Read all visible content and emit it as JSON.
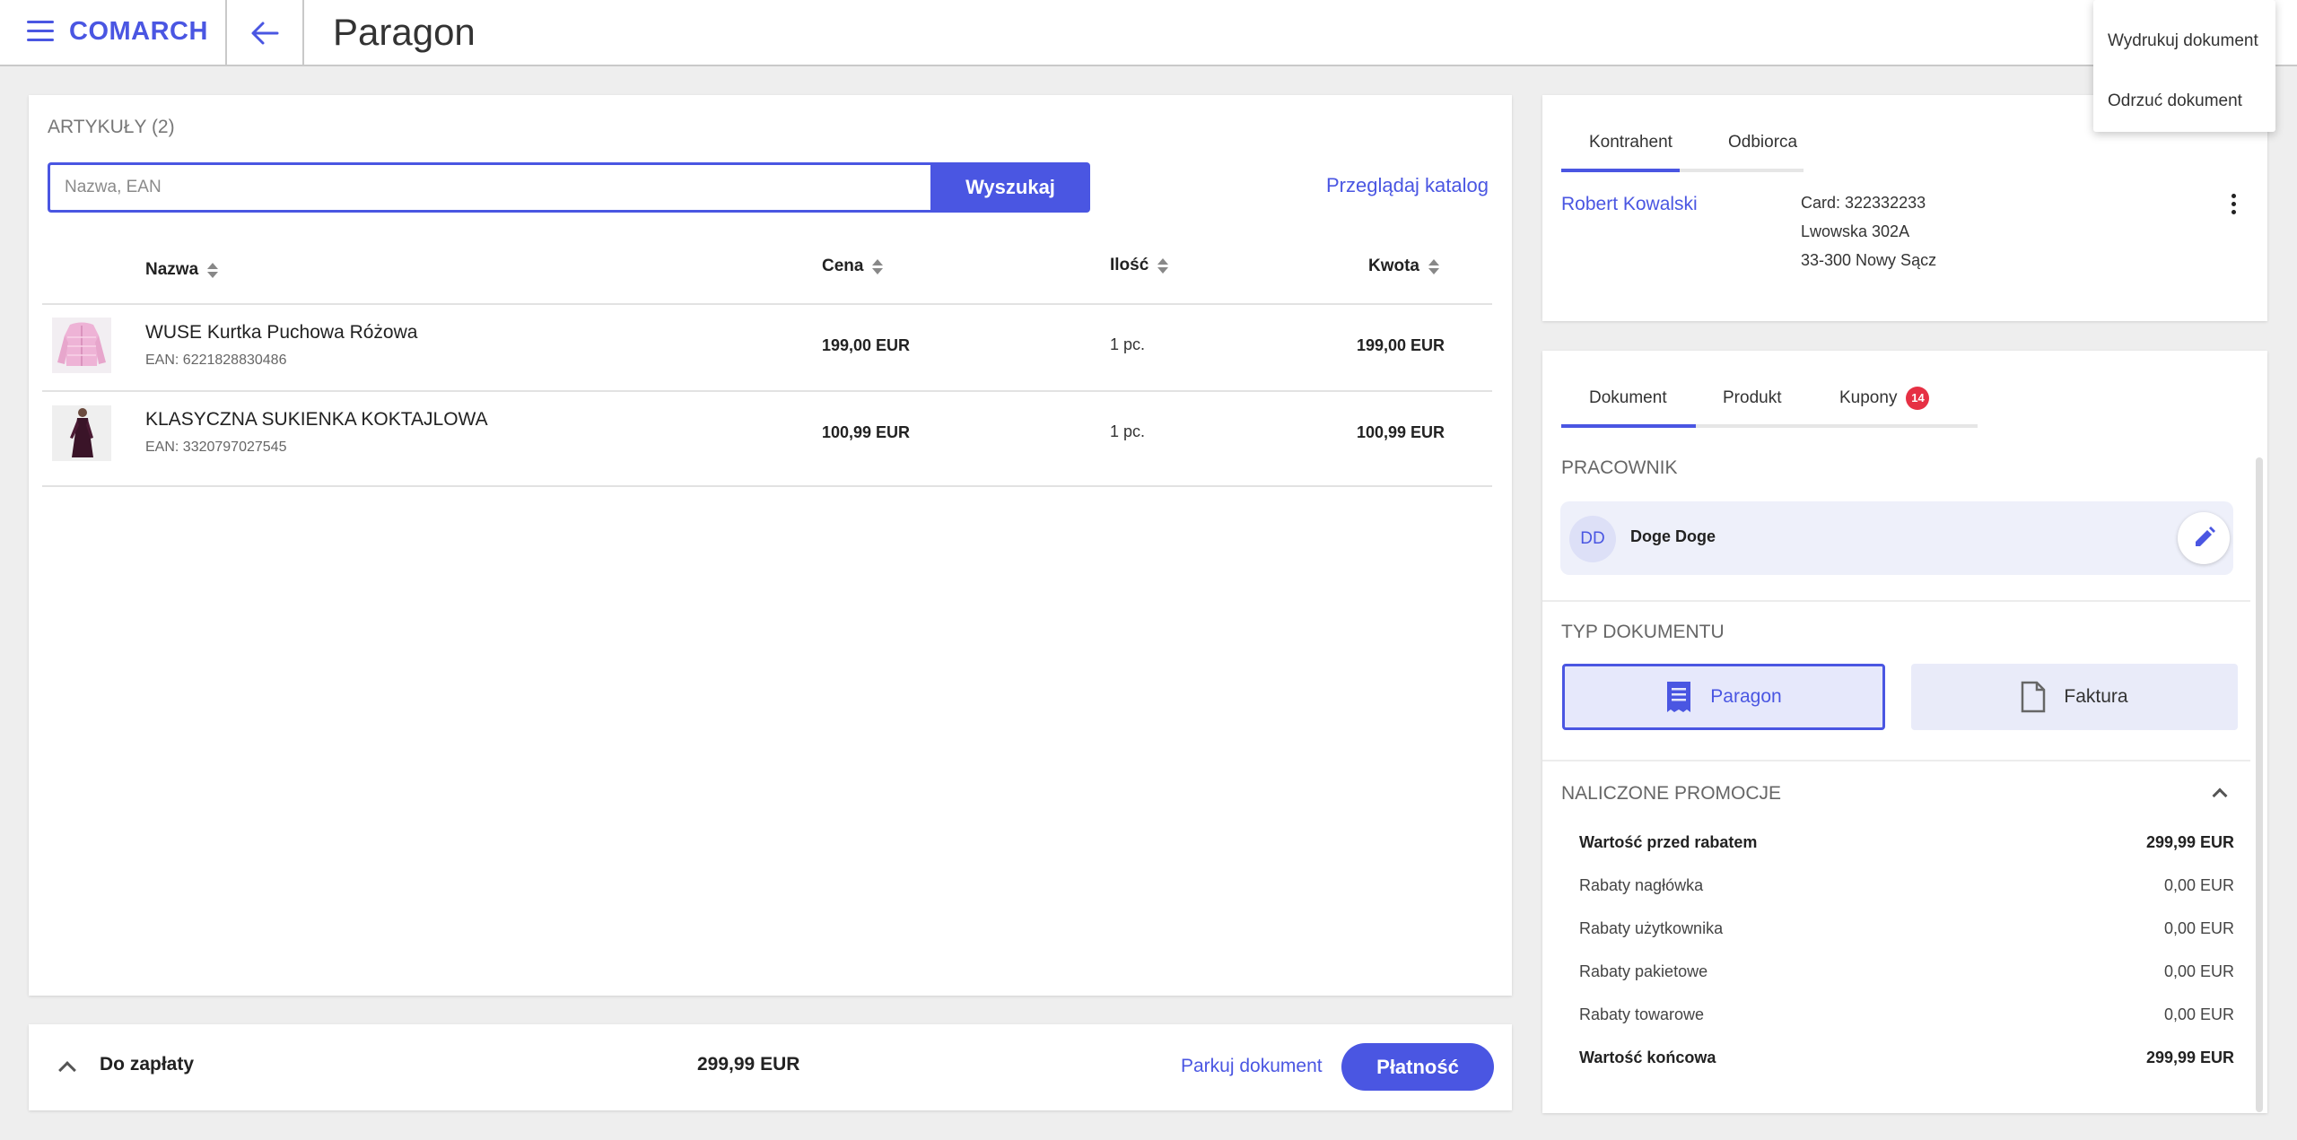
{
  "header": {
    "logo": "COMARCH",
    "title": "Paragon"
  },
  "menu": {
    "items": [
      "Wydrukuj dokument",
      "Odrzuć dokument"
    ]
  },
  "articles": {
    "title": "ARTYKUŁY (2)",
    "search_placeholder": "Nazwa, EAN",
    "search_button": "Wyszukaj",
    "catalog_link": "Przeglądaj katalog",
    "columns": [
      "Nazwa",
      "Cena",
      "Ilość",
      "Kwota"
    ],
    "rows": [
      {
        "name": "WUSE Kurtka Puchowa Różowa",
        "ean": "EAN: 6221828830486",
        "price": "199,00 EUR",
        "qty": "1 pc.",
        "amount": "199,00 EUR",
        "thumb": "pink-jacket"
      },
      {
        "name": "KLASYCZNA SUKIENKA KOKTAJLOWA",
        "ean": "EAN: 3320797027545",
        "price": "100,99 EUR",
        "qty": "1 pc.",
        "amount": "100,99 EUR",
        "thumb": "dark-dress"
      }
    ]
  },
  "footer": {
    "label": "Do zapłaty",
    "total": "299,99 EUR",
    "park": "Parkuj dokument",
    "pay": "Płatność"
  },
  "client": {
    "tabs": [
      "Kontrahent",
      "Odbiorca"
    ],
    "name": "Robert Kowalski",
    "card": "Card: 322332233",
    "street": "Lwowska 302A",
    "city": "33-300 Nowy Sącz"
  },
  "doc": {
    "tabs": [
      "Dokument",
      "Produkt",
      "Kupony"
    ],
    "coupons_badge": "14",
    "employee_title": "PRACOWNIK",
    "employee_initials": "DD",
    "employee_name": "Doge Doge",
    "type_title": "TYP DOKUMENTU",
    "type_options": [
      "Paragon",
      "Faktura"
    ],
    "promo_title": "NALICZONE PROMOCJE",
    "promos": [
      {
        "label": "Wartość przed rabatem",
        "value": "299,99 EUR",
        "bold": true
      },
      {
        "label": "Rabaty nagłówka",
        "value": "0,00 EUR",
        "bold": false
      },
      {
        "label": "Rabaty użytkownika",
        "value": "0,00 EUR",
        "bold": false
      },
      {
        "label": "Rabaty pakietowe",
        "value": "0,00 EUR",
        "bold": false
      },
      {
        "label": "Rabaty towarowe",
        "value": "0,00 EUR",
        "bold": false
      },
      {
        "label": "Wartość końcowa",
        "value": "299,99 EUR",
        "bold": true
      }
    ]
  },
  "colors": {
    "accent": "#4a56e2",
    "badge": "#e63044",
    "background": "#eeeeee"
  }
}
